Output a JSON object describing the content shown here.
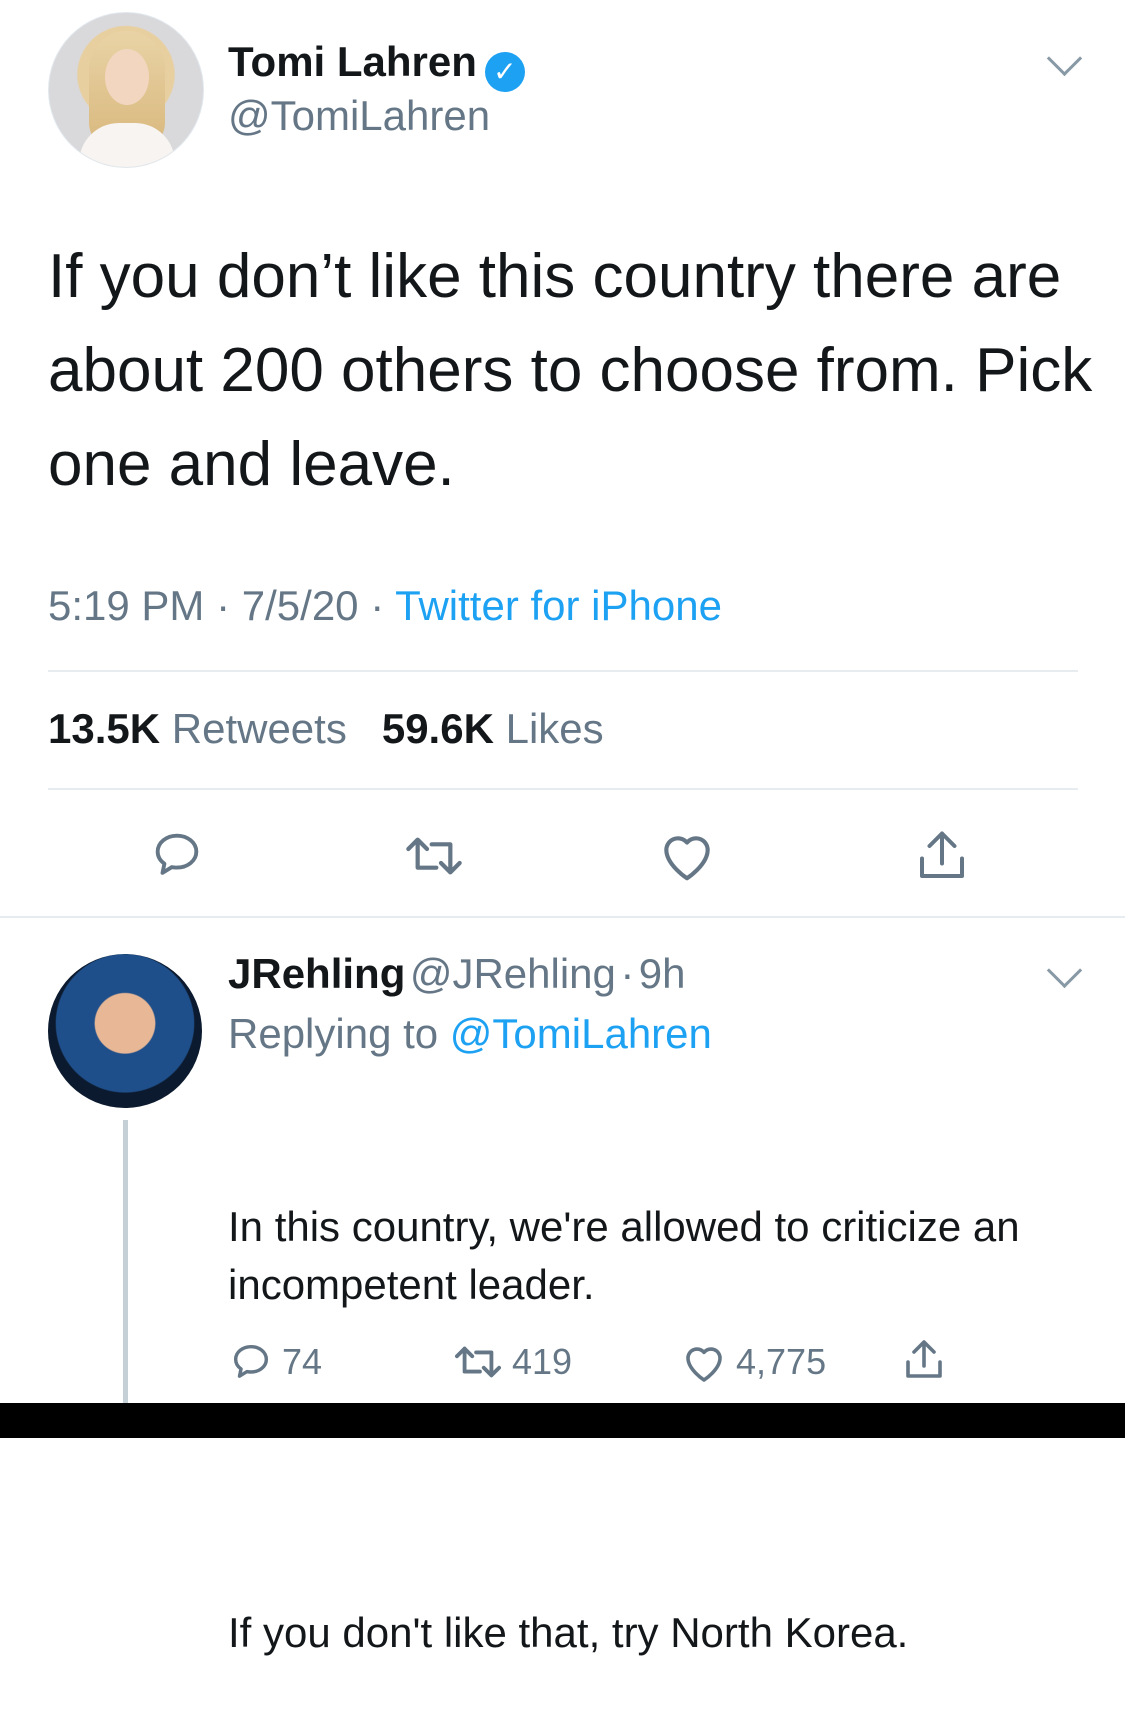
{
  "main_tweet": {
    "author_name": "Tomi Lahren",
    "author_handle": "@TomiLahren",
    "text": "If you don’t like this country there are about 200 others to choose from. Pick one and leave.",
    "time": "5:19 PM",
    "date": "7/5/20",
    "source": "Twitter for iPhone",
    "separator": "·",
    "retweets_count": "13.5K",
    "retweets_label": "Retweets",
    "likes_count": "59.6K",
    "likes_label": "Likes",
    "verified": true
  },
  "reply": {
    "author_name": "JRehling",
    "author_handle": "@JRehling",
    "time_ago": "9h",
    "separator": "·",
    "replying_prefix": "Replying to",
    "replying_to": "@TomiLahren",
    "text_line1": "In this country, we're allowed to criticize an incompetent leader.",
    "text_line2": "If you don't like that, try North Korea.",
    "reply_count": "74",
    "retweet_count": "419",
    "like_count": "4,775"
  },
  "colors": {
    "accent": "#1da1f2",
    "text": "#14171a",
    "muted": "#657786",
    "divider": "#e6ecf0"
  },
  "icons": [
    "chevron-down-icon",
    "verified-badge-icon",
    "reply-icon",
    "retweet-icon",
    "like-icon",
    "share-icon"
  ]
}
